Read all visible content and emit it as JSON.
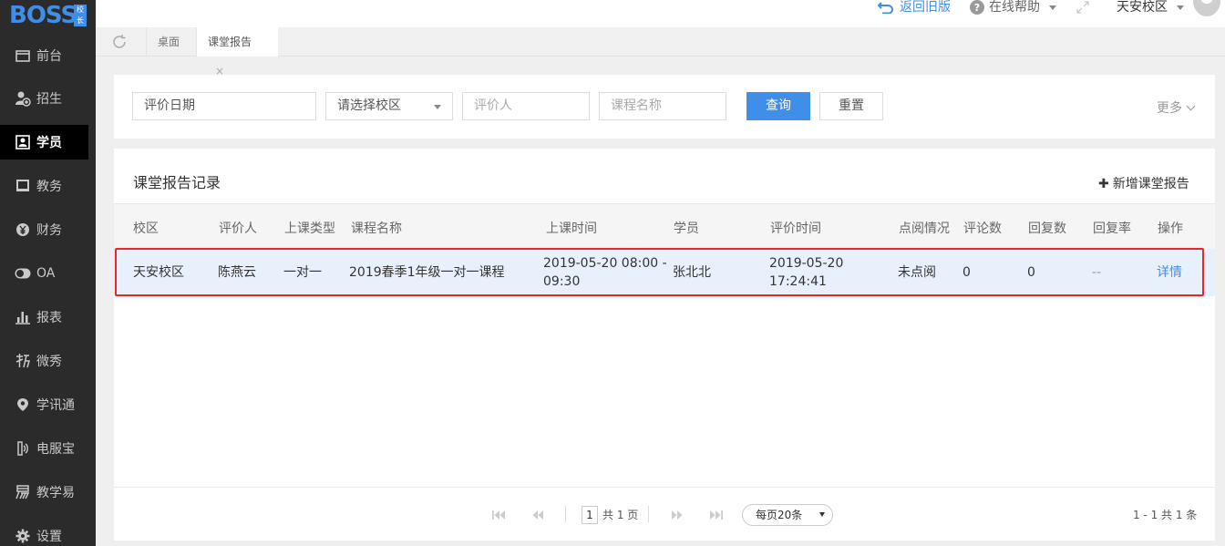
{
  "logo": {
    "text": "BOSS",
    "badge": "校长"
  },
  "sidebar": {
    "items": [
      {
        "label": "前台",
        "icon": "desk-icon"
      },
      {
        "label": "招生",
        "icon": "enroll-icon"
      },
      {
        "label": "学员",
        "icon": "student-icon"
      },
      {
        "label": "教务",
        "icon": "book-icon"
      },
      {
        "label": "财务",
        "icon": "yen-icon"
      },
      {
        "label": "OA",
        "icon": "toggle-icon"
      },
      {
        "label": "报表",
        "icon": "bar-chart-icon"
      },
      {
        "label": "微秀",
        "icon": "weixiu-icon"
      },
      {
        "label": "学讯通",
        "icon": "location-icon"
      },
      {
        "label": "电服宝",
        "icon": "phone-icon"
      },
      {
        "label": "教学易",
        "icon": "jiaoxueyi-icon"
      },
      {
        "label": "设置",
        "icon": "gear-icon"
      }
    ],
    "active_index": 2
  },
  "topbar": {
    "back_label": "返回旧版",
    "help_label": "在线帮助",
    "campus_label": "天安校区"
  },
  "tabs": {
    "home_label": "桌面",
    "active_label": "课堂报告",
    "close_glyph": "×"
  },
  "filters": {
    "date_placeholder": "评价日期",
    "campus_placeholder": "请选择校区",
    "evaluator_placeholder": "评价人",
    "course_placeholder": "课程名称",
    "query_label": "查询",
    "reset_label": "重置",
    "more_label": "更多"
  },
  "table": {
    "title": "课堂报告记录",
    "add_label": "新增课堂报告",
    "headers": {
      "campus": "校区",
      "evaluator": "评价人",
      "class_type": "上课类型",
      "course": "课程名称",
      "class_time": "上课时间",
      "student": "学员",
      "eval_time": "评价时间",
      "read_status": "点阅情况",
      "comments": "评论数",
      "replies": "回复数",
      "reply_rate": "回复率",
      "action": "操作"
    },
    "rows": [
      {
        "campus": "天安校区",
        "evaluator": "陈燕云",
        "class_type": "一对一",
        "course": "2019春季1年级一对一课程",
        "class_time_line1": "2019-05-20 08:00 -",
        "class_time_line2": "09:30",
        "student": "张北北",
        "eval_time_line1": "2019-05-20",
        "eval_time_line2": "17:24:41",
        "read_status": "未点阅",
        "comments": "0",
        "replies": "0",
        "reply_rate": "--",
        "action": "详情"
      }
    ]
  },
  "pagination": {
    "current_page": "1",
    "total_text": "共 1 页",
    "page_size": "每页20条",
    "summary": "1 - 1    共 1 条"
  },
  "colors": {
    "accent": "#3f8fe8",
    "sidebar_bg": "#2b2b2b",
    "highlight_outline": "#e8262b",
    "row_selected_bg": "#e8f0fc"
  }
}
